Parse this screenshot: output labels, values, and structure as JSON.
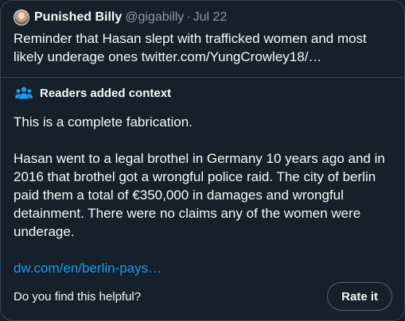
{
  "tweet": {
    "author_name": "Punished Billy",
    "handle": "@gigabilly",
    "separator": "·",
    "date": "Jul 22",
    "text": "Reminder that Hasan slept with trafficked women and most likely underage ones twitter.com/YungCrowley18/…"
  },
  "community_note": {
    "icon": "people-icon",
    "title": "Readers added context",
    "paragraphs": [
      "This is a complete fabrication.",
      "Hasan went to a legal brothel in Germany 10 years ago and in 2016 that brothel got a wrongful police raid. The city of berlin paid them a total of €350,000 in damages and wrongful detainment. There were no claims any of the women were underage."
    ],
    "link_text": "dw.com/en/berlin-pays…",
    "helpful_question": "Do you find this helpful?",
    "rate_label": "Rate it"
  },
  "colors": {
    "background": "#15202b",
    "border": "#38444d",
    "secondary_text": "#8b98a5",
    "link": "#1d9bf0",
    "note_icon": "#1d9bf0"
  }
}
